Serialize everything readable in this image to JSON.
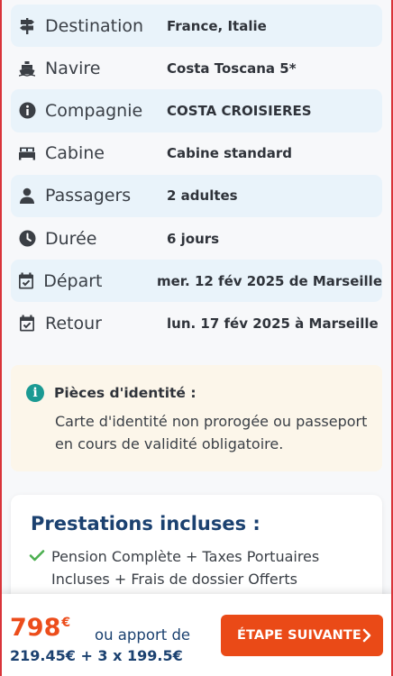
{
  "details": [
    {
      "icon": "signpost-icon",
      "label": "Destination",
      "value": "France, Italie",
      "shaded": true
    },
    {
      "icon": "ship-icon",
      "label": "Navire",
      "value": "Costa Toscana 5*",
      "shaded": false
    },
    {
      "icon": "info-icon",
      "label": "Compagnie",
      "value": "COSTA CROISIERES",
      "shaded": true
    },
    {
      "icon": "bed-icon",
      "label": "Cabine",
      "value": "Cabine standard",
      "shaded": false
    },
    {
      "icon": "user-icon",
      "label": "Passagers",
      "value": "2 adultes",
      "shaded": true
    },
    {
      "icon": "clock-icon",
      "label": "Durée",
      "value": "6 jours",
      "shaded": false
    },
    {
      "icon": "calendar-check-icon",
      "label": "Départ",
      "value": "mer. 12 fév 2025 de Marseille",
      "shaded": true
    },
    {
      "icon": "calendar-check-icon",
      "label": "Retour",
      "value": "lun. 17 fév 2025 à Marseille",
      "shaded": false
    }
  ],
  "notice": {
    "icon": "info-icon",
    "title": "Pièces d'identité :",
    "body": "Carte d'identité non prorogée ou passeport en cours de validité obligatoire."
  },
  "included": {
    "title": "Prestations incluses :",
    "icon": "check-icon",
    "item": "Pension Complète + Taxes Portuaires Incluses + Frais de dossier Offerts"
  },
  "footer": {
    "price": "798",
    "currency": "€",
    "apport_label": "ou apport de",
    "terms": "219.45€ + 3 x 199.5€",
    "button_label": "ÉTAPE SUIVANTE",
    "button_icon": "chevron-right-icon"
  },
  "colors": {
    "accent": "#ea4a17",
    "navy": "#1b4170",
    "row_shade": "#e9f3fa",
    "notice_bg": "#fcf6ea",
    "teal": "#1b9a93",
    "check_green": "#4caf50"
  }
}
